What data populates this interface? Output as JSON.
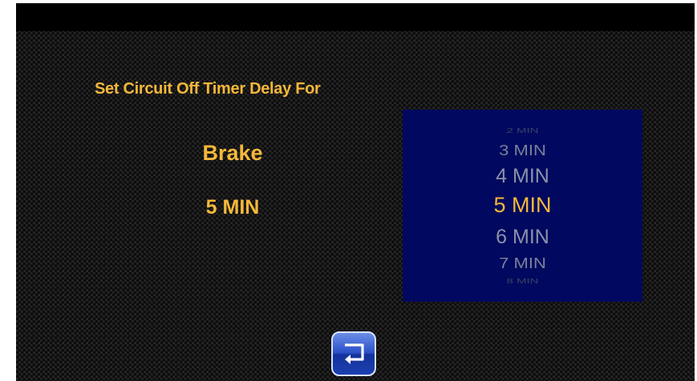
{
  "heading": "Set Circuit Off Timer Delay For",
  "circuit": {
    "name": "Brake",
    "current_value": "5 MIN"
  },
  "picker": {
    "options": [
      "2 MIN",
      "3 MIN",
      "4 MIN",
      "5 MIN",
      "6 MIN",
      "7 MIN",
      "8 MIN"
    ],
    "selected": "5 MIN"
  },
  "icons": {
    "back": "return-arrow-icon"
  },
  "colors": {
    "accent": "#f5b83a",
    "picker_bg": "#00095f",
    "button_blue": "#2a4fc6",
    "title_bar": "#000000"
  }
}
